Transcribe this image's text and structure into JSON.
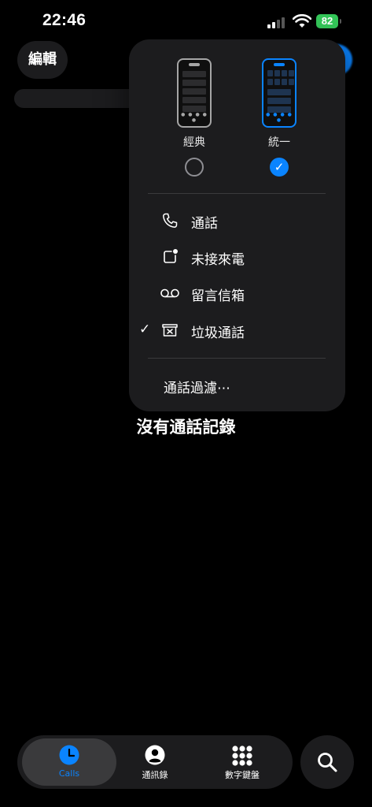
{
  "status_bar": {
    "time": "22:46",
    "battery": "82"
  },
  "header": {
    "edit_label": "編輯"
  },
  "menu": {
    "layouts": [
      {
        "label": "經典",
        "selected": false
      },
      {
        "label": "統一",
        "selected": true
      }
    ],
    "items": [
      {
        "label": "通話",
        "icon": "phone-icon",
        "checked": false
      },
      {
        "label": "未接來電",
        "icon": "missed-call-icon",
        "checked": false
      },
      {
        "label": "留言信箱",
        "icon": "voicemail-icon",
        "checked": false
      },
      {
        "label": "垃圾通話",
        "icon": "spam-box-icon",
        "checked": true
      }
    ],
    "filter_label": "通話過濾⋯"
  },
  "main": {
    "empty_message": "沒有通話記錄"
  },
  "tabbar": {
    "tabs": [
      {
        "label": "Calls",
        "icon": "clock-icon",
        "active": true
      },
      {
        "label": "通訊錄",
        "icon": "contact-icon",
        "active": false
      },
      {
        "label": "數字鍵盤",
        "icon": "keypad-icon",
        "active": false
      }
    ],
    "search_icon": "search-icon"
  },
  "colors": {
    "accent": "#0a84ff",
    "battery": "#34c759",
    "surface": "#1c1c1e"
  }
}
